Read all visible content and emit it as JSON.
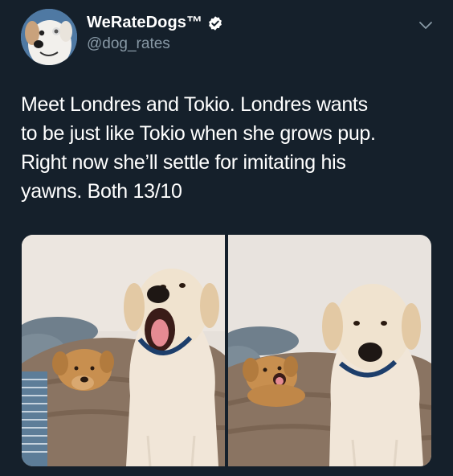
{
  "tweet": {
    "author": {
      "display_name": "WeRateDogs™",
      "handle": "@dog_rates",
      "verified": true,
      "avatar_icon": "dog-avatar-icon"
    },
    "menu_icon": "chevron-down-icon",
    "text": "Meet Londres and Tokio. Londres wants\nto be just like Tokio when she grows pup.\nRight now she’ll settle for imitating his\nyawns. Both 13/10",
    "media": [
      {
        "icon": "photo-puppy-and-yawning-dog"
      },
      {
        "icon": "photo-yawning-puppy-and-dog"
      }
    ]
  },
  "colors": {
    "background": "#15202b",
    "text_primary": "#ffffff",
    "text_secondary": "#8899a6"
  }
}
